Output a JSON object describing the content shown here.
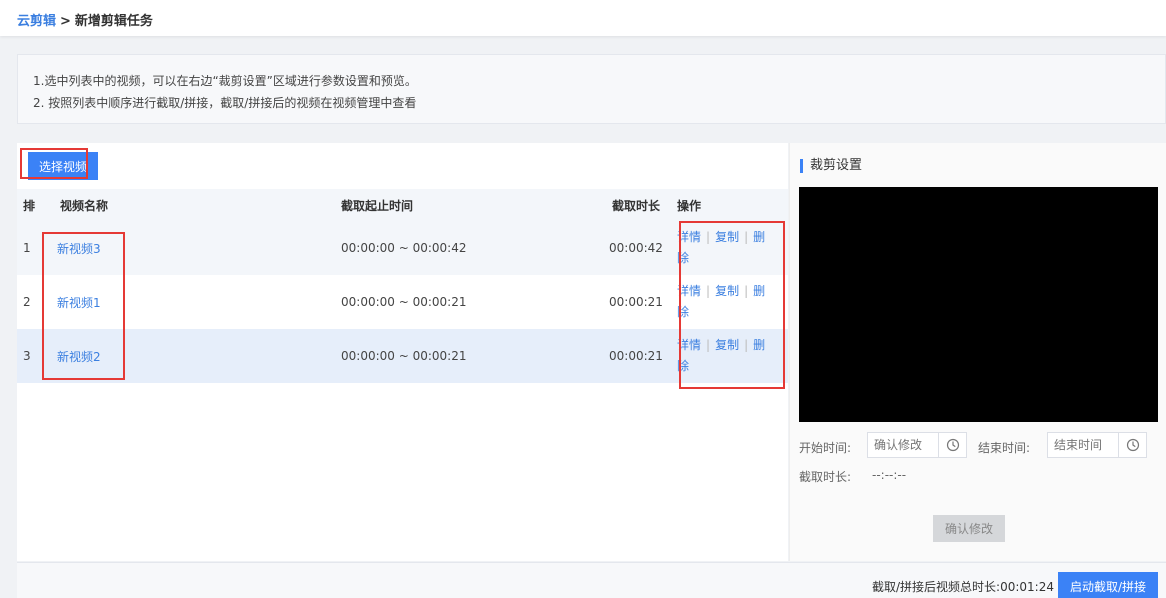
{
  "breadcrumb": {
    "root": "云剪辑",
    "separator": ">",
    "current": "新增剪辑任务"
  },
  "tips": {
    "line1": "1.选中列表中的视频，可以在右边“裁剪设置”区域进行参数设置和预览。",
    "line2": "2. 按照列表中顺序进行截取/拼接，截取/拼接后的视频在视频管理中查看"
  },
  "toolbar": {
    "select_video": "选择视频"
  },
  "table": {
    "headers": {
      "index": "排",
      "name": "视频名称",
      "time_range": "截取起止时间",
      "duration": "截取时长",
      "actions": "操作"
    },
    "rows": [
      {
        "index": "1",
        "name": "新视频3",
        "time_range": "00:00:00 ~ 00:00:42",
        "duration": "00:00:42"
      },
      {
        "index": "2",
        "name": "新视频1",
        "time_range": "00:00:00 ~ 00:00:21",
        "duration": "00:00:21"
      },
      {
        "index": "3",
        "name": "新视频2",
        "time_range": "00:00:00 ~ 00:00:21",
        "duration": "00:00:21"
      }
    ],
    "actions": {
      "detail": "详情",
      "copy": "复制",
      "delete": "删除",
      "divider": "|"
    }
  },
  "crop_settings": {
    "title": "裁剪设置",
    "start_label": "开始时间:",
    "start_placeholder": "确认修改",
    "end_label": "结束时间:",
    "end_placeholder": "结束时间",
    "duration_label": "截取时长:",
    "duration_value": "--:--:--",
    "confirm_button": "确认修改"
  },
  "footer": {
    "total_label": "截取/拼接后视频总时长:",
    "total_value": "00:01:24",
    "start_button": "启动截取/拼接"
  },
  "colors": {
    "accent": "#3b82f6",
    "link": "#3b7fe0",
    "highlight": "#e53935"
  }
}
